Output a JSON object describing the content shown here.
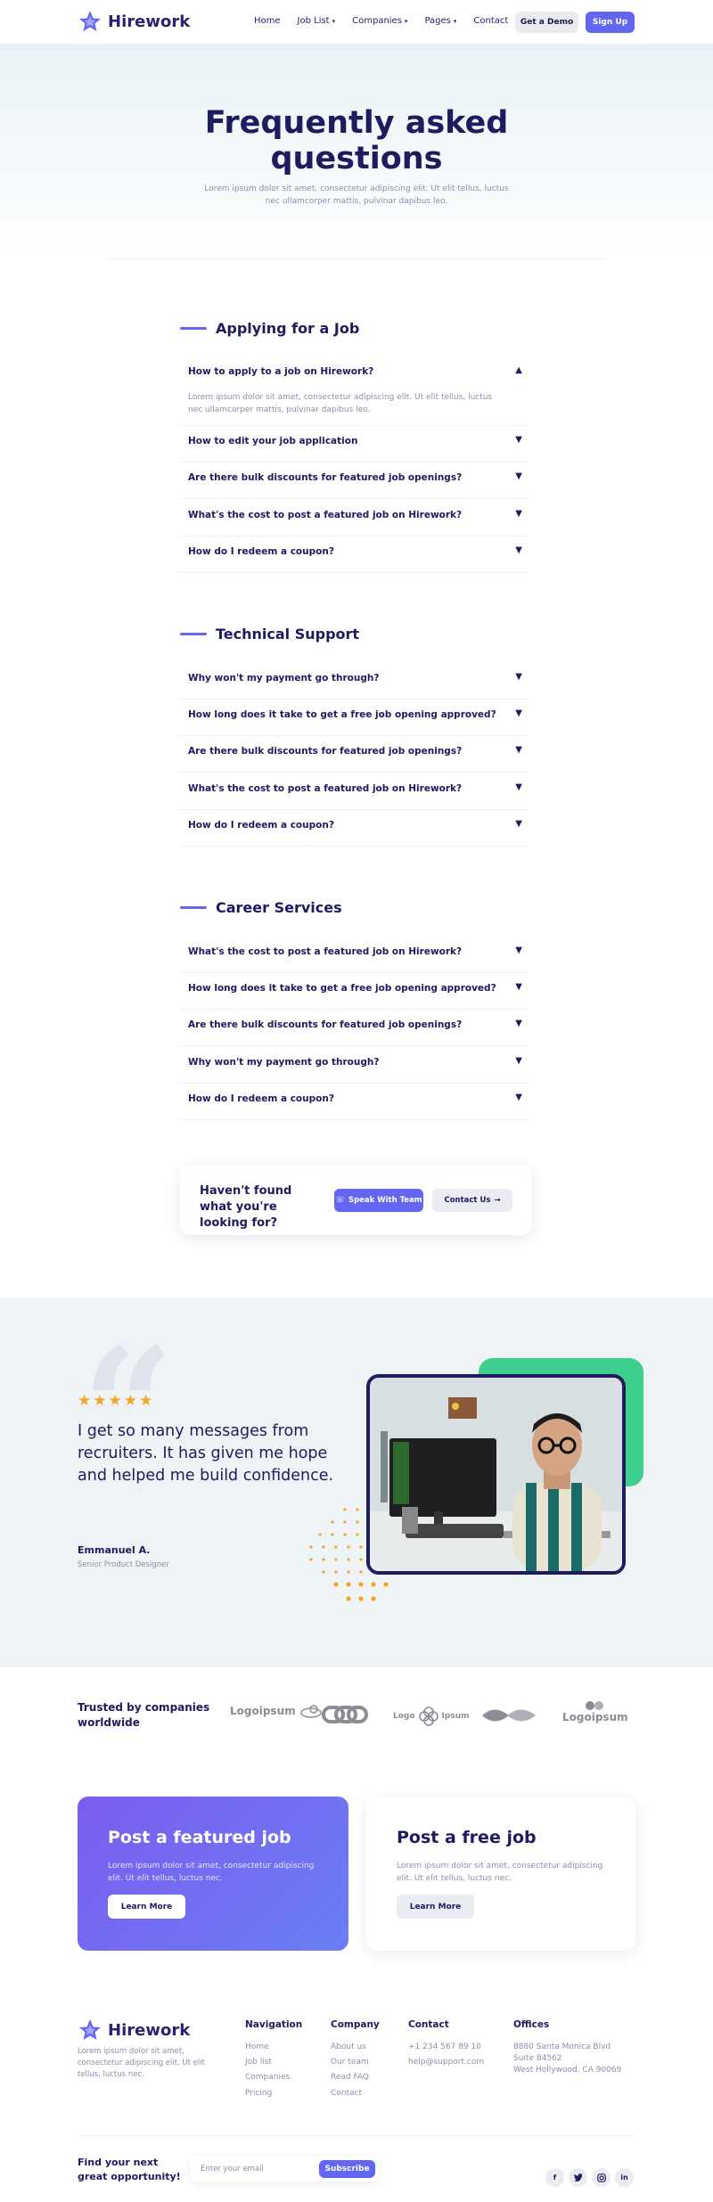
{
  "brand": {
    "name": "Hirework"
  },
  "nav": {
    "items": [
      "Home",
      "Job List",
      "Companies",
      "Pages",
      "Contact"
    ],
    "get_demo": "Get a Demo",
    "sign_up": "Sign Up"
  },
  "hero": {
    "title": "Frequently asked questions",
    "subtitle": "Lorem ipsum dolor sit amet, consectetur adipiscing elit. Ut elit tellus, luctus nec ullamcorper mattis, pulvinar dapibus leo."
  },
  "faq_sections": [
    {
      "title": "Applying for a Job",
      "items": [
        {
          "q": "How to apply to a job on Hirework?",
          "a": "Lorem ipsum dolor sit amet, consectetur adipiscing elit. Ut elit tellus, luctus nec ullamcorper mattis, pulvinar dapibus leo.",
          "open": true
        },
        {
          "q": "How to edit your job application"
        },
        {
          "q": "Are there bulk discounts for featured job openings?"
        },
        {
          "q": "What's the cost to post a featured job on Hirework?"
        },
        {
          "q": "How do I redeem a coupon?"
        }
      ]
    },
    {
      "title": "Technical Support",
      "items": [
        {
          "q": "Why won't my payment go through?"
        },
        {
          "q": "How long does it take to get a free job opening approved?"
        },
        {
          "q": "Are there bulk discounts for featured job openings?"
        },
        {
          "q": "What's the cost to post a featured job on Hirework?"
        },
        {
          "q": "How do I redeem a coupon?"
        }
      ]
    },
    {
      "title": "Career Services",
      "items": [
        {
          "q": "What's the cost to post a featured job on Hirework?"
        },
        {
          "q": "How long does it take to get a free job opening approved?"
        },
        {
          "q": "Are there bulk discounts for featured job openings?"
        },
        {
          "q": "Why won't my payment go through?"
        },
        {
          "q": "How do I redeem a coupon?"
        }
      ]
    }
  ],
  "cta": {
    "text": "Haven't found what you're looking for?",
    "speak": "Speak With Team",
    "contact": "Contact Us"
  },
  "testimonial": {
    "rating": 5,
    "quote": "I get so many messages from recruiters. It has given me hope and helped me build confidence.",
    "name": "Emmanuel A.",
    "role": "Senior Product Designer"
  },
  "trusted": {
    "title": "Trusted by companies worldwide",
    "logos": [
      "Logoipsum",
      "Logo",
      "Ipsum",
      "Logoipsum"
    ]
  },
  "post_cards": [
    {
      "title": "Post a featured job",
      "text": "Lorem ipsum dolor sit amet, consectetur adipiscing elit. Ut elit tellus, luctus nec.",
      "button": "Learn More"
    },
    {
      "title": "Post a free job",
      "text": "Lorem ipsum dolor sit amet, consectetur adipiscing elit. Ut elit tellus, luctus nec.",
      "button": "Learn More"
    }
  ],
  "footer": {
    "description": "Lorem ipsum dolor sit amet, consectetur adipiscing elit. Ut elit tellus, luctus nec.",
    "navigation": {
      "title": "Navigation",
      "links": [
        "Home",
        "Job list",
        "Companies",
        "Pricing"
      ]
    },
    "company": {
      "title": "Company",
      "links": [
        "About us",
        "Our team",
        "Read FAQ",
        "Contact"
      ]
    },
    "contact": {
      "title": "Contact",
      "lines": [
        "+1 234 567 89 10",
        "help@support.com"
      ]
    },
    "offices": {
      "title": "Offices",
      "lines": [
        "8880 Santa Monica Blvd",
        "Suite 84562",
        "West Hollywood, CA 90069"
      ]
    },
    "newsletter": {
      "text": "Find your next great opportunity!",
      "placeholder": "Enter your email",
      "button": "Subscribe"
    },
    "social": [
      "facebook-icon",
      "twitter-icon",
      "instagram-icon",
      "linkedin-icon"
    ]
  },
  "colors": {
    "primary": "#6366f1",
    "navy": "#1e1b5e",
    "green": "#3ecf8e",
    "star": "#f5a623"
  }
}
